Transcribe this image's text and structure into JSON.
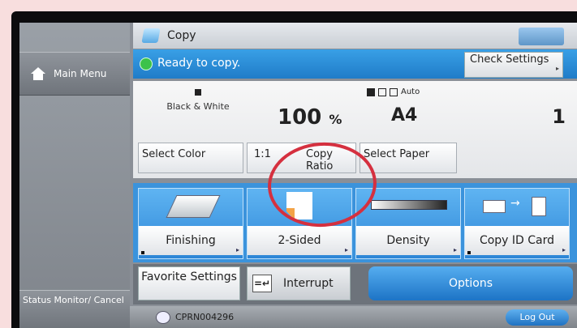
{
  "header": {
    "title": "Copy"
  },
  "status": {
    "message": "Ready to copy.",
    "check_settings": "Check Settings"
  },
  "sidebar": {
    "main_menu": "Main Menu",
    "status_monitor": "Status Monitor/ Cancel"
  },
  "info": {
    "color_mode": "Black & White",
    "ratio_value": "100",
    "ratio_unit": "%",
    "paper_source": "Auto",
    "paper_size": "A4",
    "quantity": "1"
  },
  "selectors": {
    "select_color": "Select Color",
    "ratio_prefix": "1:1",
    "copy_ratio": "Copy Ratio",
    "select_paper": "Select Paper"
  },
  "functions": {
    "finishing": "Finishing",
    "two_sided": "2-Sided",
    "density": "Density",
    "copy_id_card": "Copy ID Card"
  },
  "bottom": {
    "favorite_settings": "Favorite Settings",
    "interrupt": "Interrupt",
    "options": "Options"
  },
  "footer": {
    "user": "CPRN004296",
    "logout": "Log Out"
  },
  "colors": {
    "accent_blue": "#2d86d6",
    "annotation_red": "#d5303f",
    "ready_green": "#3cc24a"
  }
}
